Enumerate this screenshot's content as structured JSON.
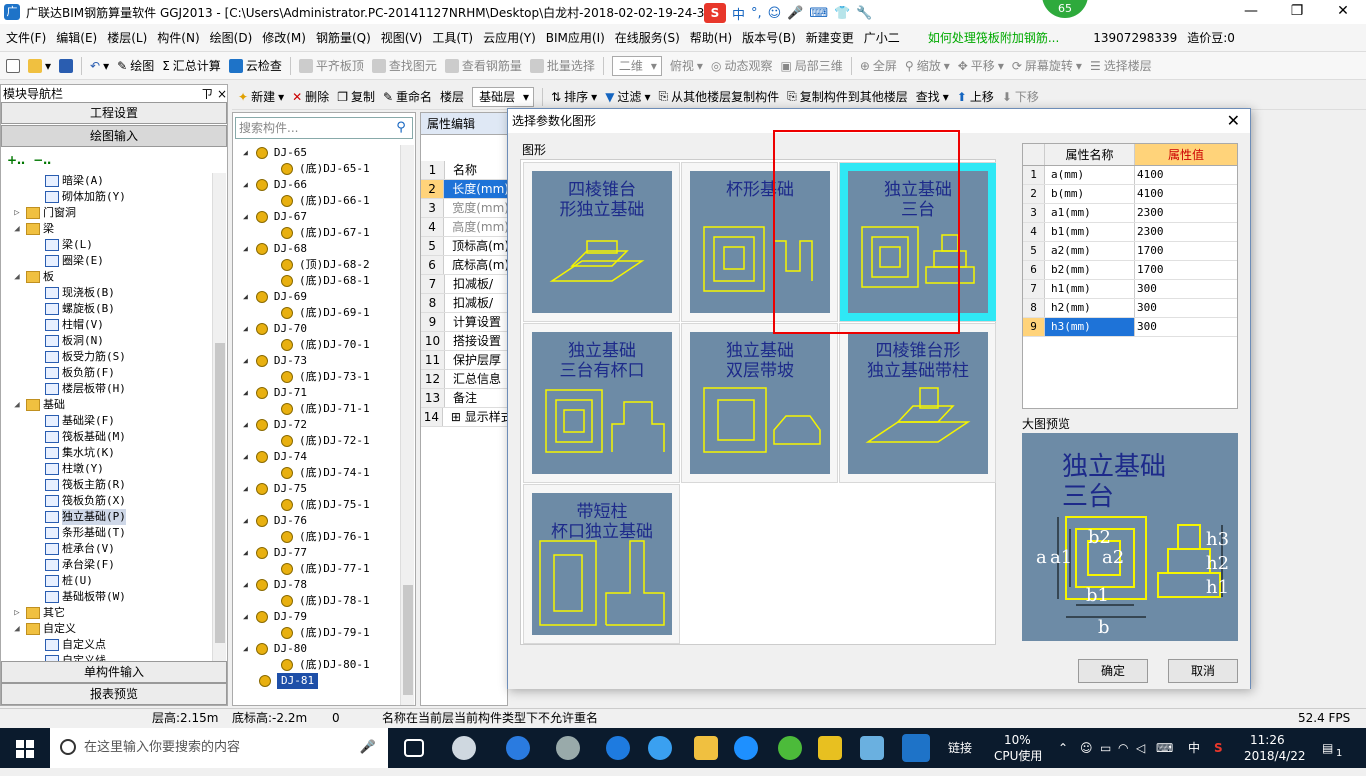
{
  "window": {
    "title": "广联达BIM钢筋算量软件 GGJ2013 - [C:\\Users\\Administrator.PC-20141127NRHM\\Desktop\\白龙村-2018-02-02-19-24-35",
    "ime_labels": [
      "中",
      "°,",
      "☺",
      "🎤",
      "⌨",
      "👕",
      "🔧"
    ],
    "badge": "65"
  },
  "menu": [
    "文件(F)",
    "编辑(E)",
    "楼层(L)",
    "构件(N)",
    "绘图(D)",
    "修改(M)",
    "钢筋量(Q)",
    "视图(V)",
    "工具(T)",
    "云应用(Y)",
    "BIM应用(I)",
    "在线服务(S)",
    "帮助(H)",
    "版本号(B)",
    "新建变更",
    "广小二",
    "如何处理筏板附加钢筋...",
    "13907298339",
    "造价豆:0"
  ],
  "toolbar1": {
    "draw": "绘图",
    "sum": "汇总计算",
    "cloudcheck": "云检查",
    "align": "平齐板顶",
    "find": "查找图元",
    "viewrebar": "查看钢筋量",
    "batch": "批量选择",
    "view2d": "二维",
    "top": "俯视",
    "dynamic": "动态观察",
    "local3d": "局部三维",
    "fullscreen": "全屏",
    "zoom": "缩放",
    "pan": "平移",
    "rotate": "屏幕旋转",
    "selfloor": "选择楼层"
  },
  "toolbar2": {
    "new": "新建",
    "delete": "删除",
    "copy": "复制",
    "rename": "重命名",
    "floor": "楼层",
    "floor_value": "基础层",
    "sort": "排序",
    "filter": "过滤",
    "copyfrom": "从其他楼层复制构件",
    "copyto": "复制构件到其他楼层",
    "find": "查找",
    "up": "上移",
    "down": "下移"
  },
  "leftpanel": {
    "title": "模块导航栏",
    "pin": "ㄗ ×",
    "buttons": [
      "工程设置",
      "绘图输入"
    ],
    "bottom_buttons": [
      "单构件输入",
      "报表预览"
    ],
    "tree": [
      {
        "label": "暗梁(A)",
        "level": 2
      },
      {
        "label": "砌体加筋(Y)",
        "level": 2
      },
      {
        "label": "门窗洞",
        "level": 0,
        "folder": true,
        "exp": "▷"
      },
      {
        "label": "梁",
        "level": 0,
        "folder": true,
        "exp": "◢"
      },
      {
        "label": "梁(L)",
        "level": 2
      },
      {
        "label": "圈梁(E)",
        "level": 2
      },
      {
        "label": "板",
        "level": 0,
        "folder": true,
        "exp": "◢"
      },
      {
        "label": "现浇板(B)",
        "level": 2
      },
      {
        "label": "螺旋板(B)",
        "level": 2
      },
      {
        "label": "柱帽(V)",
        "level": 2
      },
      {
        "label": "板洞(N)",
        "level": 2
      },
      {
        "label": "板受力筋(S)",
        "level": 2
      },
      {
        "label": "板负筋(F)",
        "level": 2
      },
      {
        "label": "楼层板带(H)",
        "level": 2
      },
      {
        "label": "基础",
        "level": 0,
        "folder": true,
        "exp": "◢"
      },
      {
        "label": "基础梁(F)",
        "level": 2
      },
      {
        "label": "筏板基础(M)",
        "level": 2
      },
      {
        "label": "集水坑(K)",
        "level": 2
      },
      {
        "label": "柱墩(Y)",
        "level": 2
      },
      {
        "label": "筏板主筋(R)",
        "level": 2
      },
      {
        "label": "筏板负筋(X)",
        "level": 2
      },
      {
        "label": "独立基础(P)",
        "level": 2,
        "sel": true
      },
      {
        "label": "条形基础(T)",
        "level": 2
      },
      {
        "label": "桩承台(V)",
        "level": 2
      },
      {
        "label": "承台梁(F)",
        "level": 2
      },
      {
        "label": "桩(U)",
        "level": 2
      },
      {
        "label": "基础板带(W)",
        "level": 2
      },
      {
        "label": "其它",
        "level": 0,
        "folder": true,
        "exp": "▷"
      },
      {
        "label": "自定义",
        "level": 0,
        "folder": true,
        "exp": "◢"
      },
      {
        "label": "自定义点",
        "level": 2
      },
      {
        "label": "自定义线",
        "level": 2
      }
    ]
  },
  "search": {
    "placeholder": "搜索构件..."
  },
  "components": [
    {
      "label": "DJ-65",
      "level": 1
    },
    {
      "label": "(底)DJ-65-1",
      "level": 2
    },
    {
      "label": "DJ-66",
      "level": 1
    },
    {
      "label": "(底)DJ-66-1",
      "level": 2
    },
    {
      "label": "DJ-67",
      "level": 1
    },
    {
      "label": "(底)DJ-67-1",
      "level": 2
    },
    {
      "label": "DJ-68",
      "level": 1
    },
    {
      "label": "(顶)DJ-68-2",
      "level": 2
    },
    {
      "label": "(底)DJ-68-1",
      "level": 2
    },
    {
      "label": "DJ-69",
      "level": 1
    },
    {
      "label": "(底)DJ-69-1",
      "level": 2
    },
    {
      "label": "DJ-70",
      "level": 1
    },
    {
      "label": "(底)DJ-70-1",
      "level": 2
    },
    {
      "label": "DJ-73",
      "level": 1
    },
    {
      "label": "(底)DJ-73-1",
      "level": 2
    },
    {
      "label": "DJ-71",
      "level": 1
    },
    {
      "label": "(底)DJ-71-1",
      "level": 2
    },
    {
      "label": "DJ-72",
      "level": 1
    },
    {
      "label": "(底)DJ-72-1",
      "level": 2
    },
    {
      "label": "DJ-74",
      "level": 1
    },
    {
      "label": "(底)DJ-74-1",
      "level": 2
    },
    {
      "label": "DJ-75",
      "level": 1
    },
    {
      "label": "(底)DJ-75-1",
      "level": 2
    },
    {
      "label": "DJ-76",
      "level": 1
    },
    {
      "label": "(底)DJ-76-1",
      "level": 2
    },
    {
      "label": "DJ-77",
      "level": 1
    },
    {
      "label": "(底)DJ-77-1",
      "level": 2
    },
    {
      "label": "DJ-78",
      "level": 1
    },
    {
      "label": "(底)DJ-78-1",
      "level": 2
    },
    {
      "label": "DJ-79",
      "level": 1
    },
    {
      "label": "(底)DJ-79-1",
      "level": 2
    },
    {
      "label": "DJ-80",
      "level": 1
    },
    {
      "label": "(底)DJ-80-1",
      "level": 2
    },
    {
      "label": "DJ-81",
      "level": 1,
      "sel": true
    }
  ],
  "propedit": {
    "tab": "属性编辑",
    "rows": [
      {
        "n": "1",
        "v": "名称"
      },
      {
        "n": "2",
        "v": "长度(mm)",
        "hl": true
      },
      {
        "n": "3",
        "v": "宽度(mm)",
        "gr": true
      },
      {
        "n": "4",
        "v": "高度(mm)",
        "gr": true
      },
      {
        "n": "5",
        "v": "顶标高(m)"
      },
      {
        "n": "6",
        "v": "底标高(m)"
      },
      {
        "n": "7",
        "v": "扣减板/"
      },
      {
        "n": "8",
        "v": "扣减板/"
      },
      {
        "n": "9",
        "v": "计算设置"
      },
      {
        "n": "10",
        "v": "搭接设置"
      },
      {
        "n": "11",
        "v": "保护层厚"
      },
      {
        "n": "12",
        "v": "汇总信息"
      },
      {
        "n": "13",
        "v": "备注"
      },
      {
        "n": "14",
        "v": "⊞ 显示样式"
      }
    ]
  },
  "dialog": {
    "title": "选择参数化图形",
    "group_label": "图形",
    "shapes": [
      {
        "title1": "四棱锥台",
        "title2": "形独立基础"
      },
      {
        "title1": "杯形基础",
        "title2": ""
      },
      {
        "title1": "独立基础",
        "title2": "三台",
        "selected": true
      },
      {
        "title1": "独立基础",
        "title2": "三台有杯口"
      },
      {
        "title1": "独立基础",
        "title2": "双层带坡"
      },
      {
        "title1": "四棱锥台形",
        "title2": "独立基础带柱"
      },
      {
        "title1": "带短柱",
        "title2": "杯口独立基础"
      }
    ],
    "param_header": {
      "name": "属性名称",
      "value": "属性值"
    },
    "params": [
      {
        "n": "1",
        "name": "a(mm)",
        "value": "4100"
      },
      {
        "n": "2",
        "name": "b(mm)",
        "value": "4100"
      },
      {
        "n": "3",
        "name": "a1(mm)",
        "value": "2300"
      },
      {
        "n": "4",
        "name": "b1(mm)",
        "value": "2300"
      },
      {
        "n": "5",
        "name": "a2(mm)",
        "value": "1700"
      },
      {
        "n": "6",
        "name": "b2(mm)",
        "value": "1700"
      },
      {
        "n": "7",
        "name": "h1(mm)",
        "value": "300"
      },
      {
        "n": "8",
        "name": "h2(mm)",
        "value": "300"
      },
      {
        "n": "9",
        "name": "h3(mm)",
        "value": "300",
        "sel": true
      }
    ],
    "preview_label": "大图预览",
    "preview_title1": "独立基础",
    "preview_title2": "三台",
    "ok": "确定",
    "cancel": "取消"
  },
  "statusbar": {
    "floor_height": "层高:2.15m",
    "bottom_height": "底标高:-2.2m",
    "zero": "0",
    "msg": "名称在当前层当前构件类型下不允许重名",
    "fps": "52.4 FPS"
  },
  "taskbar": {
    "search_placeholder": "在这里输入你要搜索的内容",
    "link": "链接",
    "cpu": "10%",
    "cpu_label": "CPU使用",
    "ime": "中",
    "time": "11:26",
    "date": "2018/4/22",
    "notif": "1"
  },
  "colors": {
    "accent_selection": "#1e73d8",
    "preview_bg": "#6d8ba6",
    "shape_line": "#f5f500",
    "highlight_cyan": "#2fe8f5",
    "annotation_red": "#e00000"
  }
}
